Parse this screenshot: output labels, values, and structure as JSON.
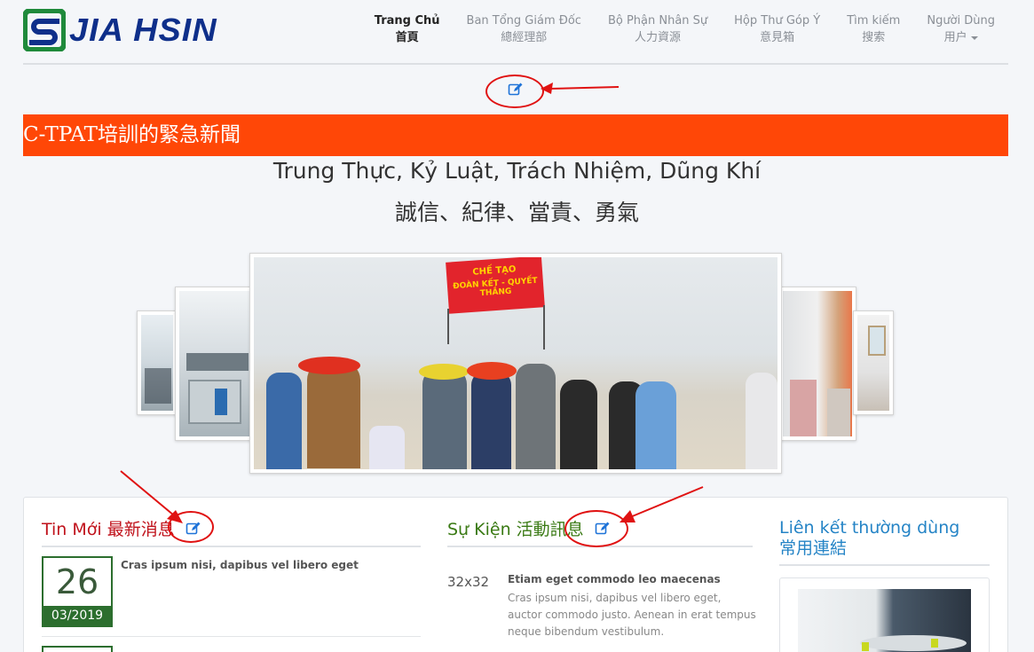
{
  "brand": {
    "logo_text": "JIA HSIN",
    "logo_primary": "#0e2f8a",
    "logo_accent": "#1f8a3b"
  },
  "nav": {
    "items": [
      {
        "line1": "Trang Chủ",
        "line2": "首頁",
        "active": true
      },
      {
        "line1": "Ban Tổng Giám Đốc",
        "line2": "總經理部",
        "active": false
      },
      {
        "line1": "Bộ Phận Nhân Sự",
        "line2": "人力資源",
        "active": false
      },
      {
        "line1": "Hộp Thư Góp Ý",
        "line2": "意見箱",
        "active": false
      },
      {
        "line1": "Tìm kiếm",
        "line2": "搜索",
        "active": false
      },
      {
        "line1": "Người Dùng",
        "line2": "用户",
        "active": false,
        "dropdown": true
      }
    ]
  },
  "banner": {
    "text": "C-TPAT培訓的緊急新聞",
    "color": "#ff4707"
  },
  "motto": {
    "line1": "Trung Thực, Kỷ Luật, Trách Nhiệm, Dũng Khí",
    "line2": "誠信、紀律、當責、勇氣"
  },
  "carousel": {
    "slide_count": 5,
    "active_slide": 3,
    "flag_line1": "CHẾ TẠO",
    "flag_line2": "ĐOÀN KẾT - QUYẾT THẮNG"
  },
  "sections": {
    "news": {
      "title": "Tin Mới 最新消息",
      "items": [
        {
          "day": "26",
          "month_year": "03/2019",
          "title": "Cras ipsum nisi, dapibus vel libero eget"
        }
      ]
    },
    "events": {
      "title": "Sự Kiện 活動訊息",
      "items": [
        {
          "thumb": "32x32",
          "title": "Etiam eget commodo leo maecenas",
          "body": "Cras ipsum nisi, dapibus vel libero eget, auctor commodo justo. Aenean in erat tempus neque bibendum vestibulum."
        }
      ]
    },
    "links": {
      "title_line1": "Liên kết thường dùng",
      "title_line2": "常用連結"
    }
  },
  "icons": {
    "edit": "edit-icon",
    "annotation": "red-circle-arrow"
  },
  "colors": {
    "edit_icon": "#1e73d8",
    "annotation": "#e01212",
    "news_title": "#c0121b",
    "events_title": "#3a7a14",
    "links_title": "#2584c6",
    "date_box": "#2c6e2e"
  }
}
